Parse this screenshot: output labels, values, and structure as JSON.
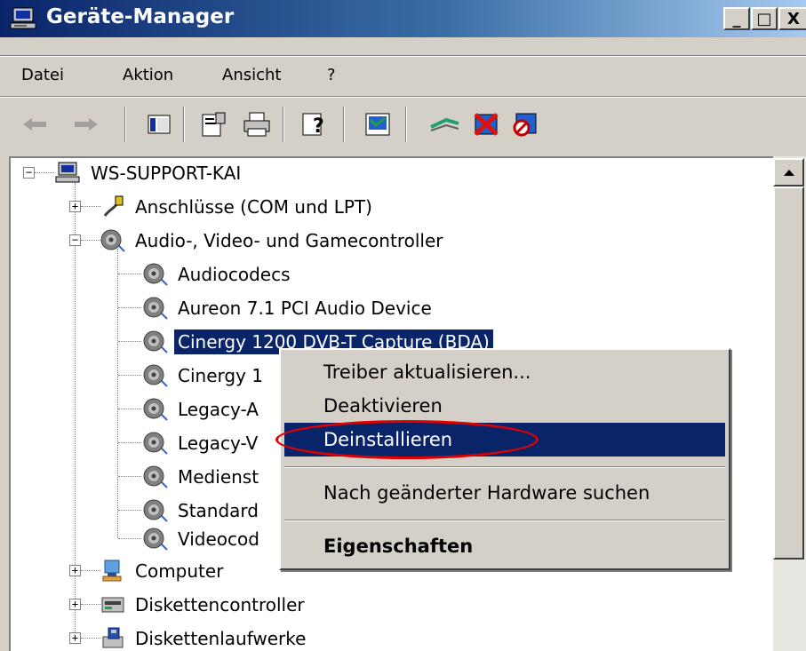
{
  "window": {
    "title": "Geräte-Manager",
    "controls": {
      "minimize": "_",
      "maximize": "□",
      "close": "X"
    }
  },
  "menu": [
    "Datei",
    "Aktion",
    "Ansicht",
    "?"
  ],
  "toolbar_icons": [
    "back-arrow-icon",
    "forward-arrow-icon",
    "show-hide-console-tree-icon",
    "properties-icon",
    "print-icon",
    "help-icon",
    "scan-hardware-icon",
    "update-driver-icon",
    "uninstall-icon",
    "disable-icon"
  ],
  "tree": {
    "root": "WS-SUPPORT-KAI",
    "items": [
      {
        "label": "Anschlüsse (COM und LPT)",
        "expanded": false
      },
      {
        "label": "Audio-, Video- und Gamecontroller",
        "expanded": true,
        "children": [
          "Audiocodecs",
          "Aureon 7.1 PCI Audio Device",
          "Cinergy 1200 DVB-T Capture (BDA)",
          "Cinergy 1",
          "Legacy-A",
          "Legacy-V",
          "Medienst",
          "Standard",
          "Videocod"
        ]
      },
      {
        "label": "Computer",
        "expanded": false
      },
      {
        "label": "Diskettencontroller",
        "expanded": false
      },
      {
        "label": "Diskettenlaufwerke",
        "expanded": false
      }
    ],
    "selected": "Cinergy 1200 DVB-T Capture (BDA)"
  },
  "context_menu": {
    "items": [
      {
        "label": "Treiber aktualisieren..."
      },
      {
        "label": "Deaktivieren"
      },
      {
        "label": "Deinstallieren"
      },
      {
        "label": "Nach geänderter Hardware suchen"
      },
      {
        "label": "Eigenschaften"
      }
    ],
    "highlighted": "Deinstallieren",
    "highlight_color": "#0a246a",
    "annotation_color": "#e00000"
  }
}
